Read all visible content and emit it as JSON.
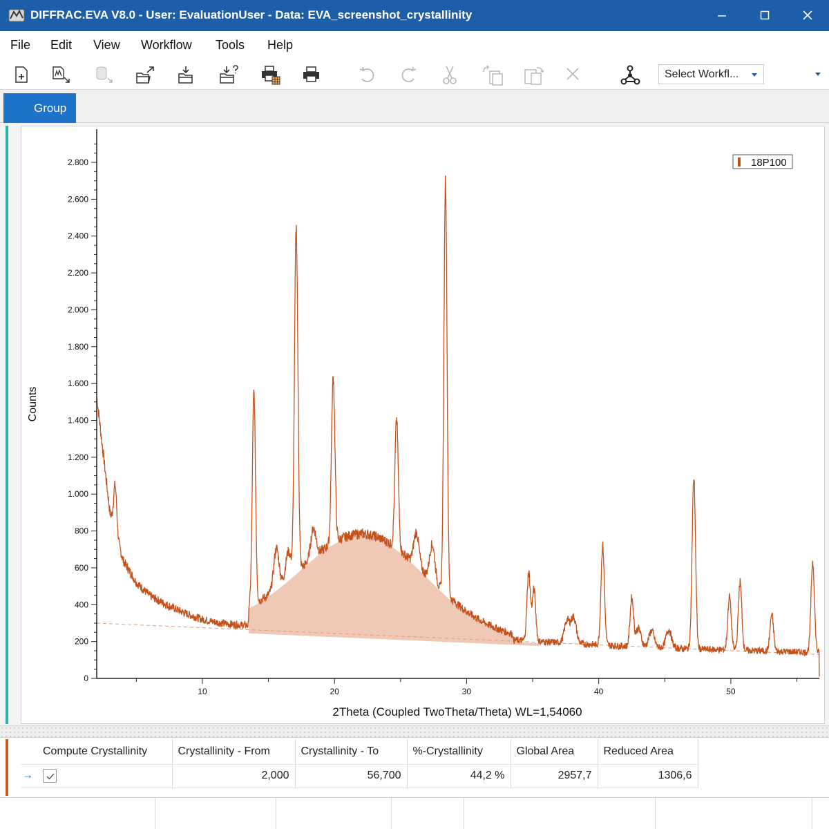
{
  "window": {
    "title": "DIFFRAC.EVA V8.0 - User: EvaluationUser - Data: EVA_screenshot_crystallinity",
    "accent_color": "#1c5ea8"
  },
  "menu": [
    "File",
    "Edit",
    "View",
    "Workflow",
    "Tools",
    "Help"
  ],
  "toolbar": {
    "icons": [
      "new-document-icon",
      "import-scan-icon",
      "database-icon",
      "export-icon",
      "import-icon",
      "import-help-icon",
      "print-preview-icon",
      "print-icon",
      "undo-icon",
      "redo-icon",
      "cut-icon",
      "copy-icon",
      "paste-icon",
      "delete-icon",
      "workflow-icon"
    ],
    "workflow_select_value": "Select Workfl..."
  },
  "tabs": [
    {
      "label": "Group",
      "active": true
    }
  ],
  "chart_data": {
    "type": "line",
    "ylabel": "Counts",
    "xlabel": "2Theta (Coupled TwoTheta/Theta) WL=1,54060",
    "xlim": [
      2,
      56.7
    ],
    "ylim": [
      0,
      2950
    ],
    "x_ticks": [
      10,
      20,
      30,
      40,
      50
    ],
    "y_ticks": [
      0,
      200,
      400,
      600,
      800,
      1000,
      1200,
      1400,
      1600,
      1800,
      2000,
      2200,
      2400,
      2600,
      2800
    ],
    "y_tick_labels": [
      "0",
      "200",
      "400",
      "600",
      "800",
      "1.000",
      "1.200",
      "1.400",
      "1.600",
      "1.800",
      "2.000",
      "2.200",
      "2.400",
      "2.600",
      "2.800"
    ],
    "series": [
      {
        "name": "18P100",
        "color": "#c4501a"
      }
    ],
    "legend_position": "top-right",
    "amorphous_fill_color": "#f0c8b6",
    "background_line": {
      "x": [
        2,
        56.7
      ],
      "y": [
        300,
        130
      ]
    },
    "amorphous_hump": {
      "center": 22.2,
      "height": 530,
      "width": 4.8,
      "range": [
        13.5,
        33.5
      ]
    },
    "baseline_decay": {
      "x": [
        2,
        3,
        4,
        5,
        6,
        7,
        8,
        9,
        10,
        11,
        12,
        13,
        14,
        15,
        16,
        17,
        18,
        19,
        20,
        21,
        22,
        23,
        24,
        25,
        26,
        27,
        28,
        29,
        30,
        31,
        32,
        33,
        34,
        35,
        36,
        37,
        38,
        39,
        40,
        41,
        42,
        43,
        44,
        45,
        46,
        47,
        48,
        49,
        50,
        51,
        52,
        53,
        54,
        55,
        56,
        56.7
      ],
      "y": [
        1530,
        900,
        640,
        520,
        450,
        410,
        375,
        345,
        320,
        305,
        295,
        290,
        285,
        282,
        278,
        274,
        270,
        266,
        262,
        258,
        254,
        250,
        246,
        242,
        238,
        234,
        230,
        226,
        222,
        218,
        214,
        210,
        206,
        202,
        198,
        194,
        190,
        186,
        182,
        178,
        175,
        172,
        169,
        166,
        163,
        160,
        158,
        156,
        154,
        152,
        150,
        148,
        146,
        144,
        142,
        140
      ]
    },
    "peaks": [
      {
        "x": 3.4,
        "height": 250,
        "width": 0.12
      },
      {
        "x": 13.9,
        "height": 1150,
        "width": 0.12
      },
      {
        "x": 15.6,
        "height": 220,
        "width": 0.2
      },
      {
        "x": 16.5,
        "height": 150,
        "width": 0.2
      },
      {
        "x": 17.1,
        "height": 1870,
        "width": 0.13
      },
      {
        "x": 18.4,
        "height": 160,
        "width": 0.2
      },
      {
        "x": 19.9,
        "height": 900,
        "width": 0.13
      },
      {
        "x": 24.7,
        "height": 700,
        "width": 0.13
      },
      {
        "x": 26.2,
        "height": 180,
        "width": 0.2
      },
      {
        "x": 27.4,
        "height": 200,
        "width": 0.2
      },
      {
        "x": 28.4,
        "height": 2250,
        "width": 0.12
      },
      {
        "x": 34.7,
        "height": 370,
        "width": 0.13
      },
      {
        "x": 35.1,
        "height": 280,
        "width": 0.13
      },
      {
        "x": 37.6,
        "height": 120,
        "width": 0.2
      },
      {
        "x": 38.1,
        "height": 140,
        "width": 0.2
      },
      {
        "x": 40.3,
        "height": 540,
        "width": 0.13
      },
      {
        "x": 42.5,
        "height": 260,
        "width": 0.13
      },
      {
        "x": 43.0,
        "height": 100,
        "width": 0.2
      },
      {
        "x": 44.0,
        "height": 90,
        "width": 0.2
      },
      {
        "x": 45.3,
        "height": 100,
        "width": 0.2
      },
      {
        "x": 47.2,
        "height": 930,
        "width": 0.13
      },
      {
        "x": 49.9,
        "height": 290,
        "width": 0.13
      },
      {
        "x": 50.7,
        "height": 370,
        "width": 0.13
      },
      {
        "x": 53.1,
        "height": 200,
        "width": 0.13
      },
      {
        "x": 56.2,
        "height": 490,
        "width": 0.13
      }
    ]
  },
  "results_table": {
    "headers": [
      "Compute Crystallinity",
      "Crystallinity - From",
      "Crystallinity - To",
      "%-Crystallinity",
      "Global Area",
      "Reduced Area"
    ],
    "row": {
      "compute": true,
      "from": "2,000",
      "to": "56,700",
      "percent": "44,2 %",
      "global_area": "2957,7",
      "reduced_area": "1306,6"
    }
  }
}
